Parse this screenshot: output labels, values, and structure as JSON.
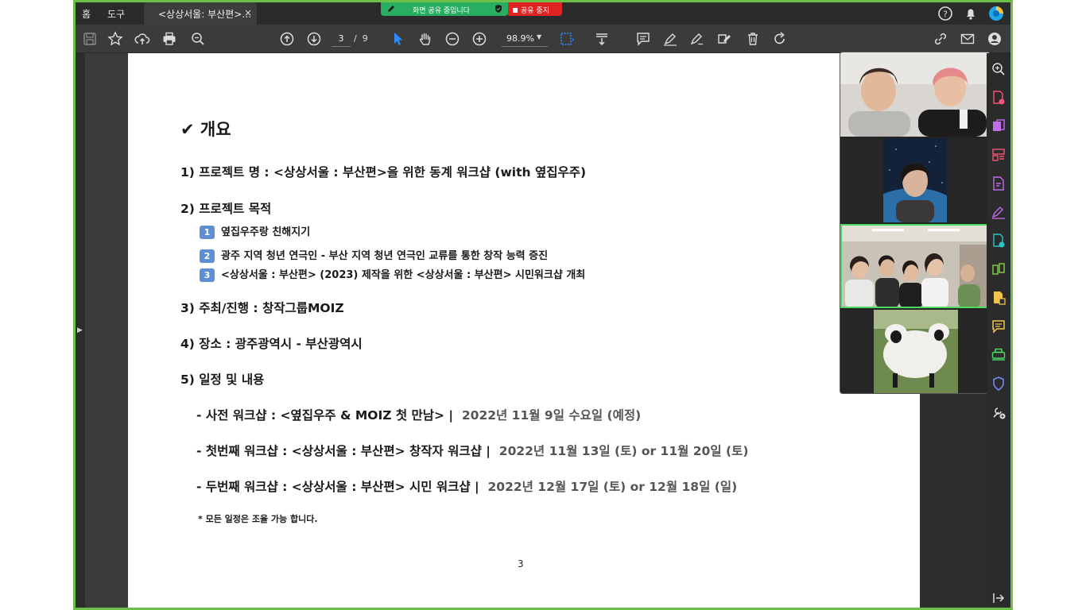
{
  "menu": {
    "home": "홈",
    "tools": "도구"
  },
  "tab": {
    "title": "<상상서울: 부산편>…",
    "close": "×"
  },
  "share": {
    "status": "화면 공유 중입니다",
    "stop": "공유 중지"
  },
  "toolbar": {
    "current_page": "3",
    "page_separator": "/",
    "total_pages": "9",
    "zoom": "98.9%"
  },
  "document": {
    "heading": "✔ 개요",
    "item1": "1)    프로젝트 명 : <상상서울 : 부산편>을 위한 동계 워크샵 (with 옆집우주)",
    "item2": "2)    프로젝트 목적",
    "goals": [
      {
        "num": "1",
        "text": "옆집우주랑 친해지기"
      },
      {
        "num": "2",
        "text": "광주 지역 청년 연극인 - 부산 지역 청년 연극인 교류를 통한 창작 능력 증진"
      },
      {
        "num": "3",
        "text": "<상상서울 : 부산편> (2023) 제작을 위한 <상상서울 : 부산편> 시민워크샵 개최"
      }
    ],
    "item3": "3) 주최/진행 : 창작그룹MOIZ",
    "item4": "4) 장소 : 광주광역시 - 부산광역시",
    "item5": "5) 일정 및 내용",
    "schedule": [
      {
        "label": "- 사전 워크샵 : <옆집우주 & MOIZ 첫 만남>  |",
        "date": "2022년 11월 9일 수요일 (예정)"
      },
      {
        "label": "- 첫번째 워크샵 : <상상서울 : 부산편> 창작자 워크샵  |",
        "date": "2022년 11월 13일 (토) or 11월 20일 (토)"
      },
      {
        "label": "- 두번째 워크샵 : <상상서울 : 부산편> 시민 워크샵  |",
        "date": "2022년 12월 17일 (토) or 12월 18일 (일)"
      }
    ],
    "note": "* 모든 일정은 조율 가능 합니다.",
    "page_number": "3"
  },
  "colors": {
    "share_frame": "#6cc04a",
    "share_bar": "#27ae60",
    "stop_button": "#e02424",
    "active_speaker": "#4cd964",
    "badge": "#5f8fd3"
  }
}
